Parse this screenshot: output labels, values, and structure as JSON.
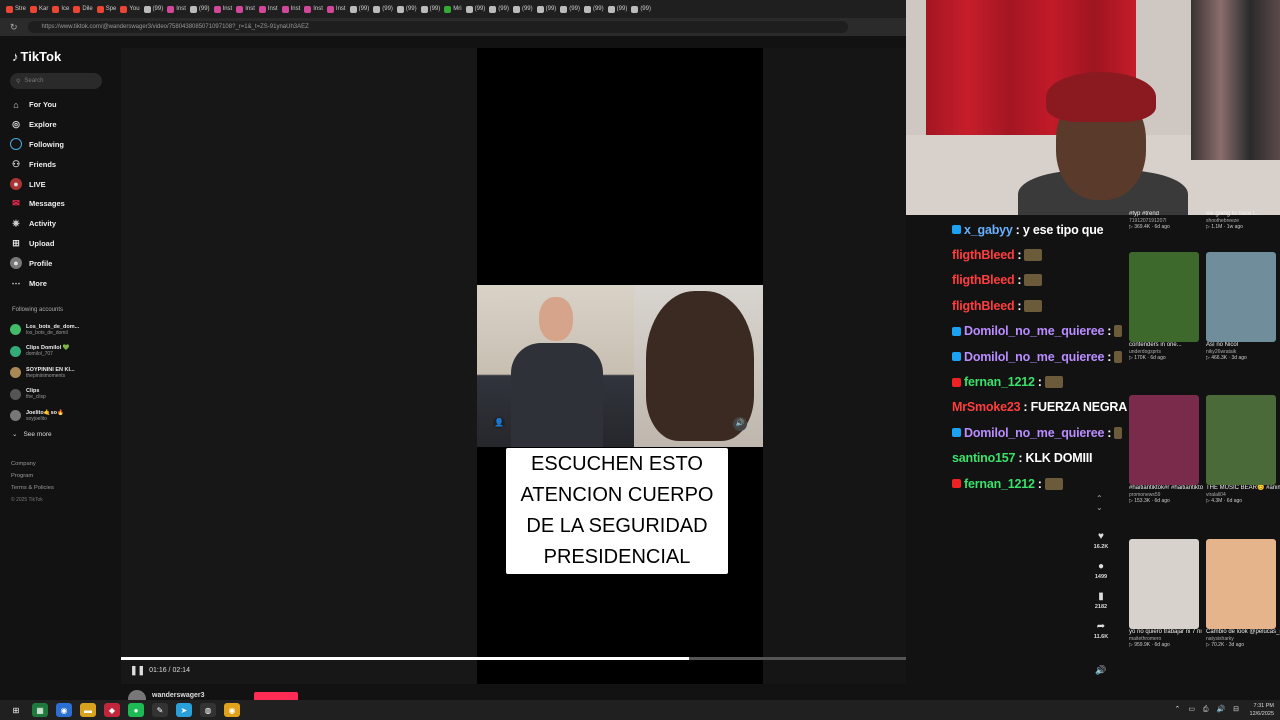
{
  "browser": {
    "url": "https://www.tiktok.com/@wanderswager3/video/7580438085071097108?_r=1&_t=ZS-91ynaUh3AEZ",
    "tabs": [
      {
        "label": "Stre",
        "color": "#e43"
      },
      {
        "label": "Kar",
        "color": "#e43"
      },
      {
        "label": "Ice",
        "color": "#e43"
      },
      {
        "label": "Dile",
        "color": "#e43"
      },
      {
        "label": "Spe",
        "color": "#e43"
      },
      {
        "label": "You",
        "color": "#e43"
      },
      {
        "label": "(99)",
        "color": "#bbb"
      },
      {
        "label": "Inst",
        "color": "#d3479a"
      },
      {
        "label": "(99)",
        "color": "#bbb"
      },
      {
        "label": "Inst",
        "color": "#d3479a"
      },
      {
        "label": "Inst",
        "color": "#d3479a"
      },
      {
        "label": "Inst",
        "color": "#d3479a"
      },
      {
        "label": "Inst",
        "color": "#d3479a"
      },
      {
        "label": "Inst",
        "color": "#d3479a"
      },
      {
        "label": "Inst",
        "color": "#d3479a"
      },
      {
        "label": "(99)",
        "color": "#bbb"
      },
      {
        "label": "(99)",
        "color": "#bbb"
      },
      {
        "label": "(99)",
        "color": "#bbb"
      },
      {
        "label": "(99)",
        "color": "#bbb"
      },
      {
        "label": "Mri",
        "color": "#3a3"
      },
      {
        "label": "(99)",
        "color": "#bbb"
      },
      {
        "label": "(99)",
        "color": "#bbb"
      },
      {
        "label": "(99)",
        "color": "#bbb"
      },
      {
        "label": "(99)",
        "color": "#bbb"
      },
      {
        "label": "(99)",
        "color": "#bbb"
      },
      {
        "label": "(99)",
        "color": "#bbb"
      },
      {
        "label": "(99)",
        "color": "#bbb"
      },
      {
        "label": "(99)",
        "color": "#bbb"
      }
    ]
  },
  "tiktok": {
    "logo": "TikTok",
    "search_placeholder": "Search",
    "nav": [
      {
        "label": "For You",
        "icon": "home-icon",
        "glyph": "⌂"
      },
      {
        "label": "Explore",
        "icon": "compass-icon",
        "glyph": "◎"
      },
      {
        "label": "Following",
        "icon": "following-icon",
        "glyph": ""
      },
      {
        "label": "Friends",
        "icon": "friends-icon",
        "glyph": "⚇"
      },
      {
        "label": "LIVE",
        "icon": "live-icon",
        "glyph": "●"
      },
      {
        "label": "Messages",
        "icon": "messages-icon",
        "glyph": "✉"
      },
      {
        "label": "Activity",
        "icon": "activity-icon",
        "glyph": "⎈"
      },
      {
        "label": "Upload",
        "icon": "upload-icon",
        "glyph": "⊞"
      },
      {
        "label": "Profile",
        "icon": "profile-icon",
        "glyph": "●"
      },
      {
        "label": "More",
        "icon": "more-icon",
        "glyph": "⋯"
      }
    ],
    "following_accounts_label": "Following accounts",
    "accounts": [
      {
        "name": "Los_bots_de_dom...",
        "handle": "los_bots_de_domil"
      },
      {
        "name": "Clips Domilol 💚",
        "handle": "domilol_707"
      },
      {
        "name": "SOYPININI EN KI...",
        "handle": "thepininimoments"
      },
      {
        "name": "Clips",
        "handle": "the_clisp"
      },
      {
        "name": "Joelito🤙so🔥",
        "handle": "soyjoelito"
      }
    ],
    "see_more": "See more",
    "footer": [
      "Company",
      "Program",
      "Terms & Policies"
    ],
    "copyright": "© 2025 TikTok",
    "caption_lines": [
      "ESCUCHEN ESTO",
      "ATENCION CUERPO",
      "DE LA SEGURIDAD",
      "PRESIDENCIAL"
    ],
    "actions": [
      {
        "icon": "heart-icon",
        "glyph": "♥",
        "count": "16.2K"
      },
      {
        "icon": "comment-icon",
        "glyph": "●",
        "count": "1499"
      },
      {
        "icon": "bookmark-icon",
        "glyph": "▮",
        "count": "2182"
      },
      {
        "icon": "share-icon",
        "glyph": "➦",
        "count": "11.6K"
      }
    ],
    "time": "01:16 / 02:14",
    "progress_fraction": 0.724,
    "author": "wanderswager3"
  },
  "chat": [
    {
      "user": "x_gabyy",
      "color": "#6ab0ff",
      "text": ": y ese tipo que",
      "emote": false,
      "badge": "#1da1f2"
    },
    {
      "user": "fligthBleed",
      "color": "#ff3d3d",
      "text": ":",
      "emote": true,
      "badge": ""
    },
    {
      "user": "fligthBleed",
      "color": "#ff3d3d",
      "text": ":",
      "emote": true,
      "badge": ""
    },
    {
      "user": "fligthBleed",
      "color": "#ff3d3d",
      "text": ":",
      "emote": true,
      "badge": ""
    },
    {
      "user": "Domilol_no_me_quieree",
      "color": "#b98cff",
      "text": ":",
      "emote": true,
      "badge": "#1da1f2"
    },
    {
      "user": "Domilol_no_me_quieree",
      "color": "#b98cff",
      "text": ":",
      "emote": true,
      "badge": "#1da1f2"
    },
    {
      "user": "fernan_1212",
      "color": "#3be06a",
      "text": ":",
      "emote": true,
      "badge": "#e22"
    },
    {
      "user": "MrSmoke23",
      "color": "#ff3d3d",
      "text": ": FUERZA NEGRA",
      "emote": false,
      "badge": ""
    },
    {
      "user": "Domilol_no_me_quieree",
      "color": "#b98cff",
      "text": ":",
      "emote": true,
      "badge": "#1da1f2"
    },
    {
      "user": "santino157",
      "color": "#3be06a",
      "text": ": KLK DOMIII",
      "emote": false,
      "badge": ""
    },
    {
      "user": "fernan_1212",
      "color": "#3be06a",
      "text": ":",
      "emote": true,
      "badge": "#e22"
    }
  ],
  "suggested": [
    {
      "title": "#fyp #trend",
      "user": "7191207191207I",
      "stats": "▷ 369.4K · 6d ago",
      "bg": "#2a2a2a"
    },
    {
      "title": "we going to have t...",
      "user": "shoothebreeze",
      "stats": "▷ 1.1M · 1w ago",
      "bg": "#2a2a2a"
    },
    {
      "title": "contenders in one...",
      "user": "underdogsprts",
      "stats": "▷ 170K · 6d ago",
      "bg": "#3d6a2c"
    },
    {
      "title": "Así no Nicol",
      "user": "niky26wrataik",
      "stats": "▷ 466.3K · 3d ago",
      "bg": "#6f8d9a"
    },
    {
      "title": "#haitiantiktok#r #haitiantiktok #fyp...",
      "user": "promonews59",
      "stats": "▷ 153.3K · 6d ago",
      "bg": "#7a2a4a"
    },
    {
      "title": "THE MUSIC BEAR😊 #animals #funny...",
      "user": "viralali04",
      "stats": "▷ 4.3M · 6d ago",
      "bg": "#4a6a3a"
    },
    {
      "title": "yo no quiero trabajar ni 7 ni 8 ni 24 ni 25...",
      "user": "maitethromero",
      "stats": "▷ 959.9K · 6d ago",
      "bg": "#d8d2cc"
    },
    {
      "title": "Cambio de look @pelucas_ive",
      "user": "natysisharky",
      "stats": "▷ 70.2K · 3d ago",
      "bg": "#e6b48a"
    }
  ],
  "taskbar": {
    "time": "7:31 PM",
    "date": "12/6/2025",
    "apps": [
      {
        "icon": "windows-icon",
        "glyph": "⊞",
        "color": "transparent"
      },
      {
        "icon": "spreadsheet-icon",
        "glyph": "▦",
        "color": "#1e7a3c"
      },
      {
        "icon": "chrome-icon",
        "glyph": "◉",
        "color": "#2a6fd1"
      },
      {
        "icon": "folder-icon",
        "glyph": "▬",
        "color": "#d9a21e"
      },
      {
        "icon": "app-red-icon",
        "glyph": "◆",
        "color": "#c2263a"
      },
      {
        "icon": "spotify-icon",
        "glyph": "●",
        "color": "#1db954"
      },
      {
        "icon": "pen-icon",
        "glyph": "✎",
        "color": "#333"
      },
      {
        "icon": "telegram-icon",
        "glyph": "➤",
        "color": "#2aa0da"
      },
      {
        "icon": "obs-icon",
        "glyph": "◍",
        "color": "#333"
      },
      {
        "icon": "chrome-alt-icon",
        "glyph": "◉",
        "color": "#e0a21a"
      }
    ]
  }
}
